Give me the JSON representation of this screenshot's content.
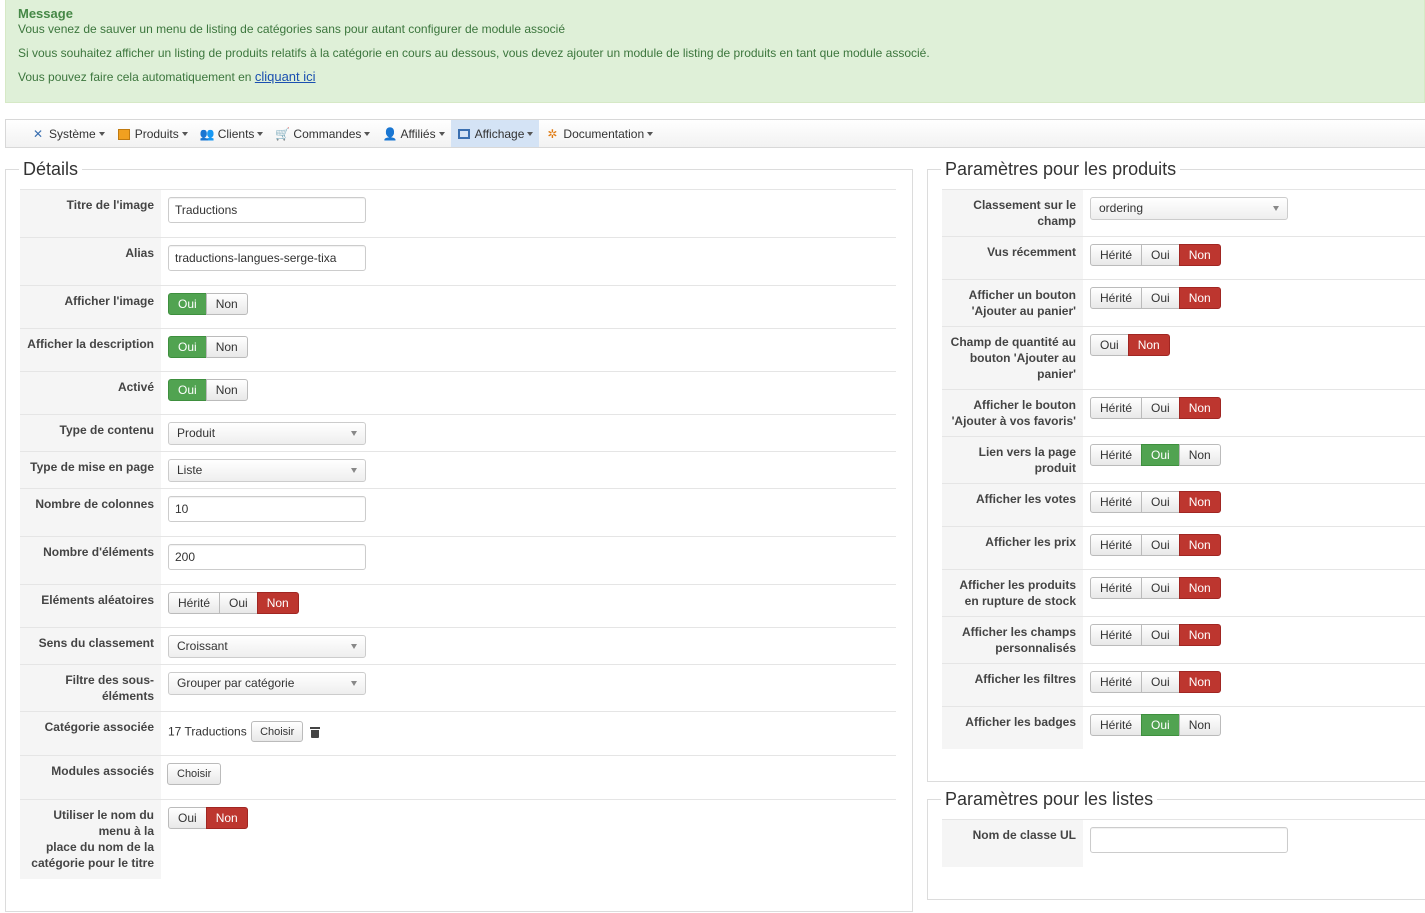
{
  "alert": {
    "title": "Message",
    "line1": "Vous venez de sauver un menu de listing de catégories sans pour autant configurer de module associé",
    "line2": "Si vous souhaitez afficher un listing de produits relatifs à la catégorie en cours au dessous, vous devez ajouter un module de listing de produits en tant que module associé.",
    "line3_prefix": "Vous pouvez faire cela automatiquement en",
    "line3_link": "cliquant ici"
  },
  "menu": [
    {
      "label": "Système",
      "icon": "tools-icon"
    },
    {
      "label": "Produits",
      "icon": "box-icon"
    },
    {
      "label": "Clients",
      "icon": "users-icon"
    },
    {
      "label": "Commandes",
      "icon": "cart-icon"
    },
    {
      "label": "Affiliés",
      "icon": "affiliate-icon"
    },
    {
      "label": "Affichage",
      "icon": "display-icon",
      "active": true
    },
    {
      "label": "Documentation",
      "icon": "documentation-icon"
    }
  ],
  "details": {
    "legend": "Détails",
    "rows": {
      "titre": {
        "label": "Titre de l'image",
        "value": "Traductions"
      },
      "alias": {
        "label": "Alias",
        "value": "traductions-langues-serge-tixa"
      },
      "afficher_image": {
        "label": "Afficher l'image",
        "yes": "Oui",
        "no": "Non"
      },
      "afficher_description": {
        "label": "Afficher la description",
        "yes": "Oui",
        "no": "Non"
      },
      "active": {
        "label": "Activé",
        "yes": "Oui",
        "no": "Non"
      },
      "type_contenu": {
        "label": "Type de contenu",
        "value": "Produit"
      },
      "type_mise_en_page": {
        "label": "Type de mise en page",
        "value": "Liste"
      },
      "nb_colonnes": {
        "label": "Nombre de colonnes",
        "value": "10"
      },
      "nb_elements": {
        "label": "Nombre d'éléments",
        "value": "200"
      },
      "aleatoires": {
        "label": "Eléments aléatoires",
        "inherit": "Hérité",
        "yes": "Oui",
        "no": "Non"
      },
      "sens": {
        "label": "Sens du classement",
        "value": "Croissant"
      },
      "filtre_l1": "Filtre des sous-",
      "filtre_l2": "éléments",
      "filtre_value": "Grouper par catégorie",
      "categorie": {
        "label": "Catégorie associée",
        "value": "17 Traductions",
        "button": "Choisir"
      },
      "modules": {
        "label": "Modules associés",
        "button": "Choisir"
      },
      "nom_l1": "Utiliser le nom du",
      "nom_l2": "menu à la",
      "nom_l3": "place du nom de la",
      "nom_l4": "catégorie pour le titre",
      "nom_yes": "Oui",
      "nom_no": "Non"
    }
  },
  "products": {
    "legend": "Paramètres pour les produits",
    "classement_l1": "Classement sur le",
    "classement_l2": "champ",
    "classement_value": "ordering",
    "vus_label": "Vus récemment",
    "panier_l1": "Afficher un bouton",
    "panier_l2": "'Ajouter au panier'",
    "qty_l1": "Champ de quantité au",
    "qty_l2": "bouton 'Ajouter au",
    "qty_l3": "panier'",
    "favoris_l1": "Afficher le bouton",
    "favoris_l2": "'Ajouter à vos favoris'",
    "lien_l1": "Lien vers la page",
    "lien_l2": "produit",
    "votes_label": "Afficher les votes",
    "prix_label": "Afficher les prix",
    "rupture_l1": "Afficher les produits",
    "rupture_l2": "en rupture de stock",
    "champs_l1": "Afficher les champs",
    "champs_l2": "personnalisés",
    "filtres_label": "Afficher les filtres",
    "badges_label": "Afficher les badges",
    "inherit": "Hérité",
    "yes": "Oui",
    "no": "Non"
  },
  "lists": {
    "legend": "Paramètres pour les listes",
    "ul_label": "Nom de classe UL",
    "ul_value": ""
  },
  "colors": {
    "alert_bg": "#dff0d8",
    "alert_title": "#468847",
    "green": "#51a351",
    "red": "#bd362f",
    "active_menu": "#d4e3f5"
  }
}
